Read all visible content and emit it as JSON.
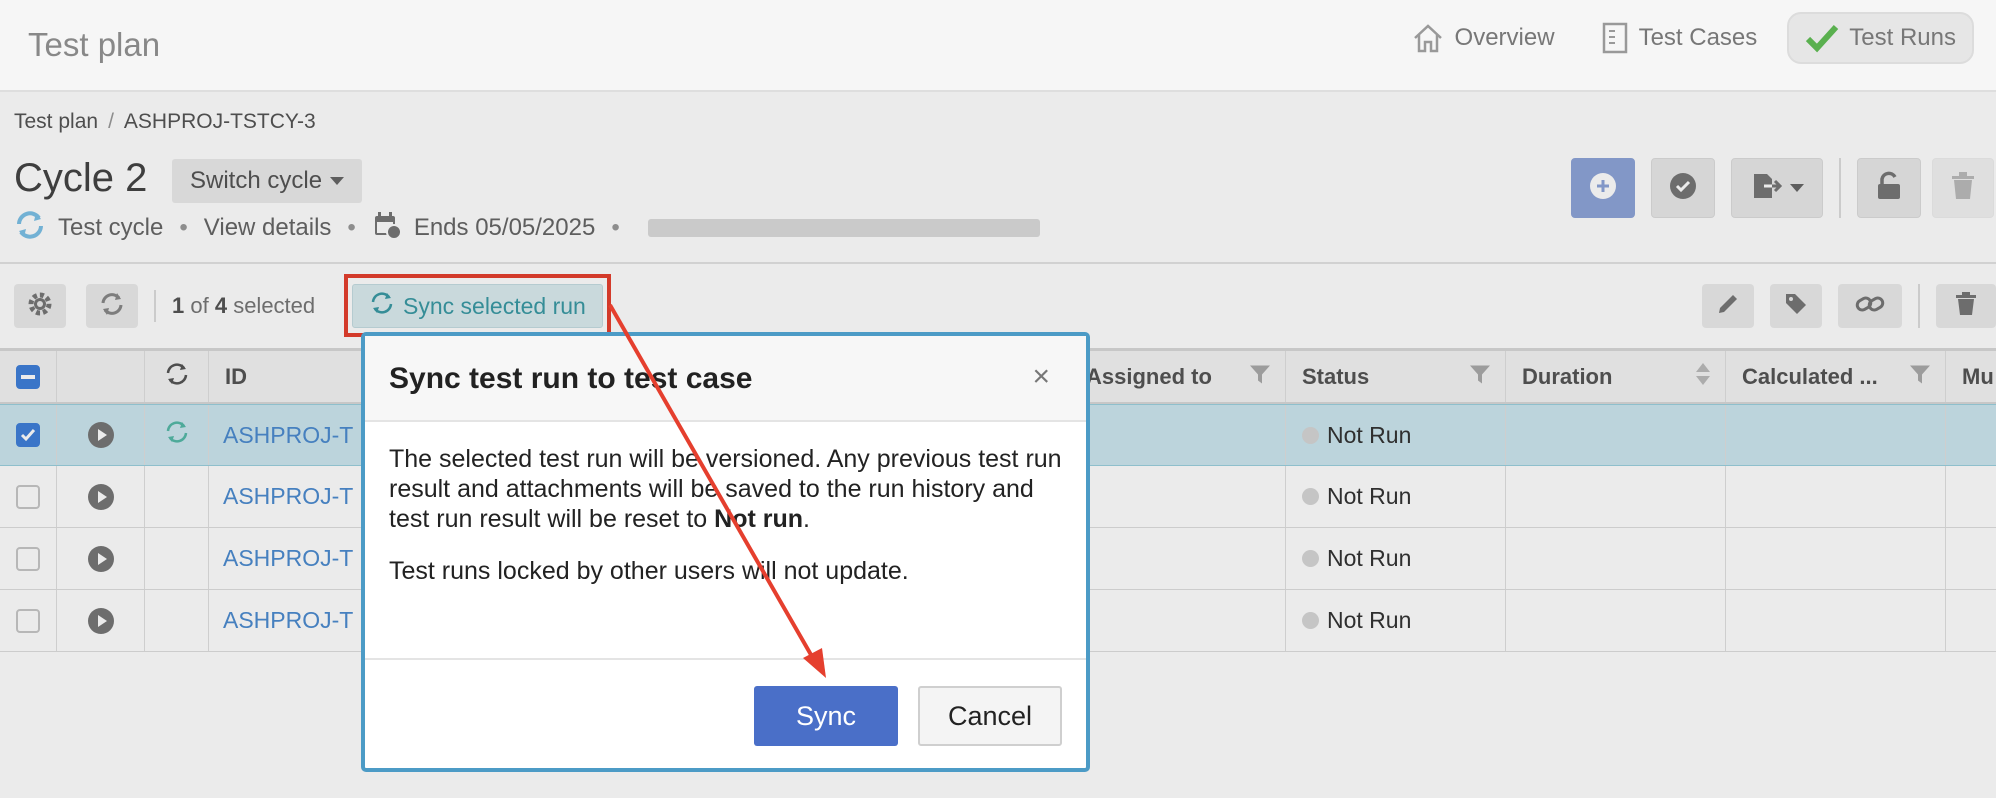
{
  "app": {
    "title": "Test plan"
  },
  "nav": {
    "tabs": [
      {
        "label": "Overview",
        "icon": "home-icon",
        "active": false
      },
      {
        "label": "Test Cases",
        "icon": "document-icon",
        "active": false
      },
      {
        "label": "Test Runs",
        "icon": "checkmark-icon",
        "active": true
      }
    ]
  },
  "breadcrumb": {
    "items": [
      "Test plan",
      "ASHPROJ-TSTCY-3"
    ],
    "separator": "/"
  },
  "cycle": {
    "title": "Cycle 2",
    "switch_label": "Switch cycle",
    "type_label": "Test cycle",
    "details_label": "View details",
    "ends_label": "Ends 05/05/2025",
    "separator": "•"
  },
  "header_actions": [
    "add-icon",
    "check-circle-icon",
    "export-icon",
    "unlock-icon",
    "trash-icon"
  ],
  "toolbar": {
    "selected_count": "1",
    "selected_of": " of ",
    "selected_total": "4",
    "selected_suffix": " selected",
    "sync_label": "Sync selected run",
    "right_tools": [
      "pencil-icon",
      "tag-icon",
      "link-icon",
      "trash-icon"
    ]
  },
  "table": {
    "columns": [
      "ID",
      "Assigned to",
      "Status",
      "Duration",
      "Calculated ...",
      "Mu"
    ],
    "rows": [
      {
        "id": "ASHPROJ-T",
        "status": "Not Run",
        "checked": true,
        "synced": true
      },
      {
        "id": "ASHPROJ-T",
        "status": "Not Run",
        "checked": false,
        "synced": false
      },
      {
        "id": "ASHPROJ-T",
        "status": "Not Run",
        "checked": false,
        "synced": false
      },
      {
        "id": "ASHPROJ-T",
        "status": "Not Run",
        "checked": false,
        "synced": false
      }
    ]
  },
  "dialog": {
    "title": "Sync test run to test case",
    "close": "×",
    "para1_start": "The selected test run will be versioned. Any previous test run result and attachments will be saved to the run history and test run result will be reset to ",
    "para1_bold": "Not run",
    "para1_end": ".",
    "para2": "Test runs locked by other users will not update.",
    "confirm": "Sync",
    "cancel": "Cancel"
  },
  "colors": {
    "primary": "#4a6fc8",
    "dialog_border": "#4c9bc6",
    "annotation": "#e53f2e",
    "link": "#4c8bd0",
    "sync_accent": "#3a9aa4"
  }
}
